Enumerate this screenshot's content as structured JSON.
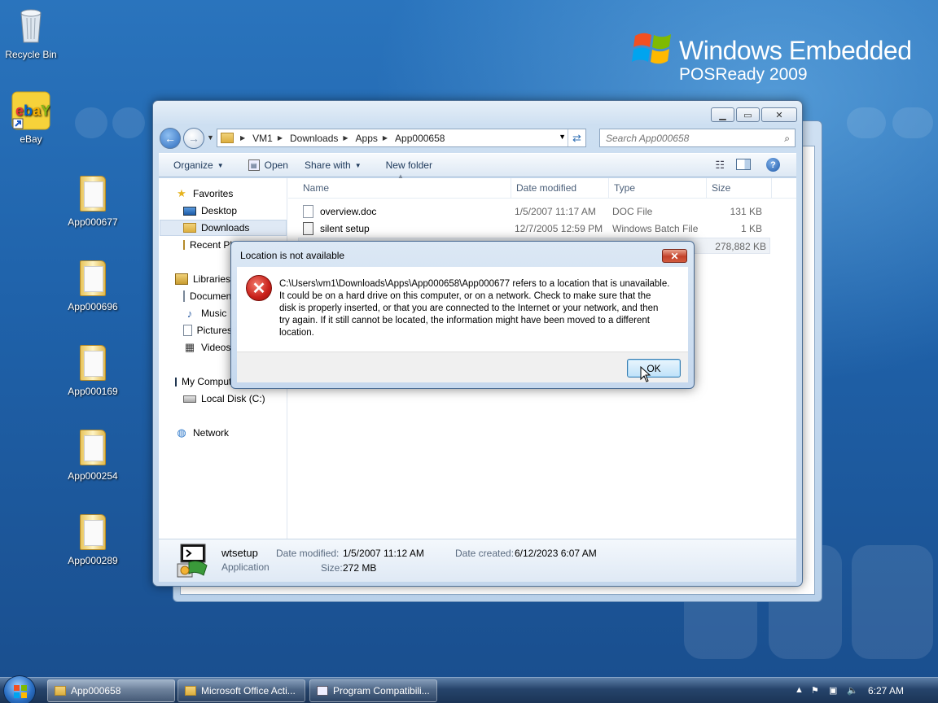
{
  "desktop": {
    "brand_line1": "Windows Embedded",
    "brand_line2": "POSReady 2009",
    "icons": [
      {
        "label": "Recycle Bin"
      },
      {
        "label": "eBay"
      },
      {
        "label": "App000677"
      },
      {
        "label": "App000696"
      },
      {
        "label": "App000169"
      },
      {
        "label": "App000254"
      },
      {
        "label": "App000289"
      }
    ]
  },
  "explorer": {
    "breadcrumb": [
      "VM1",
      "Downloads",
      "Apps",
      "App000658"
    ],
    "search_placeholder": "Search App000658",
    "toolbar": {
      "organize": "Organize",
      "open": "Open",
      "share_with": "Share with",
      "new_folder": "New folder"
    },
    "nav": {
      "favorites": "Favorites",
      "desktop": "Desktop",
      "downloads": "Downloads",
      "recent": "Recent Places",
      "libraries": "Libraries",
      "documents": "Documents",
      "music": "Music",
      "pictures": "Pictures",
      "videos": "Videos",
      "computer": "My Computer",
      "local_disk": "Local Disk (C:)",
      "network": "Network"
    },
    "columns": {
      "name": "Name",
      "date": "Date modified",
      "type": "Type",
      "size": "Size"
    },
    "files": [
      {
        "name": "overview.doc",
        "date": "1/5/2007 11:17 AM",
        "type": "DOC File",
        "size": "131 KB"
      },
      {
        "name": "silent setup",
        "date": "12/7/2005 12:59 PM",
        "type": "Windows Batch File",
        "size": "1 KB"
      },
      {
        "name": "",
        "date": "",
        "type": "",
        "size": "278,882 KB"
      }
    ],
    "details": {
      "name": "wtsetup",
      "kind": "Application",
      "modified_label": "Date modified:",
      "modified_value": "1/5/2007 11:12 AM",
      "size_label": "Size:",
      "size_value": "272 MB",
      "created_label": "Date created:",
      "created_value": "6/12/2023 6:07 AM"
    }
  },
  "dialog": {
    "title": "Location is not available",
    "message": "C:\\Users\\vm1\\Downloads\\Apps\\App000658\\App000677 refers to a location that is unavailable. It could be on a hard drive on this computer, or on a network. Check to make sure that the disk is properly inserted, or that you are connected to the Internet or your network, and then try again. If it still cannot be located, the information might have been moved to a different location.",
    "ok": "OK",
    "close_glyph": "✕"
  },
  "taskbar": {
    "buttons": [
      "App000658",
      "Microsoft Office Acti...",
      "Program Compatibili..."
    ],
    "clock": "6:27 AM"
  }
}
